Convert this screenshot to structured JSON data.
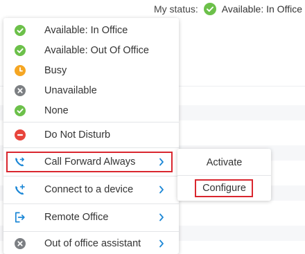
{
  "status": {
    "label": "My status:",
    "value": "Available: In Office",
    "icon": "check-circle-icon",
    "color": "#6cc04a"
  },
  "menu": {
    "items": [
      {
        "label": "Available: In Office",
        "icon": "check-circle-icon",
        "color": "#6cc04a"
      },
      {
        "label": "Available: Out Of Office",
        "icon": "check-circle-icon",
        "color": "#6cc04a"
      },
      {
        "label": "Busy",
        "icon": "clock-icon",
        "color": "#f5a623"
      },
      {
        "label": "Unavailable",
        "icon": "x-circle-icon",
        "color": "#7c7f83"
      },
      {
        "label": "None",
        "icon": "check-circle-icon",
        "color": "#6cc04a"
      },
      {
        "label": "Do Not Disturb",
        "icon": "minus-circle-icon",
        "color": "#e8453c"
      },
      {
        "label": "Call Forward Always",
        "icon": "call-forward-icon",
        "color": "#1b87d6",
        "has_submenu": true
      },
      {
        "label": "Connect to a device",
        "icon": "phone-plus-icon",
        "color": "#1b87d6",
        "has_submenu": true
      },
      {
        "label": "Remote Office",
        "icon": "remote-office-icon",
        "color": "#1b87d6",
        "has_submenu": true
      },
      {
        "label": "Out of office assistant",
        "icon": "x-circle-icon",
        "color": "#7c7f83",
        "has_submenu": true
      }
    ]
  },
  "submenu": {
    "items": [
      {
        "label": "Activate"
      },
      {
        "label": "Configure"
      }
    ]
  },
  "colors": {
    "highlight": "#d9262e",
    "accent": "#1b87d6",
    "chevron": "#1b87d6"
  }
}
